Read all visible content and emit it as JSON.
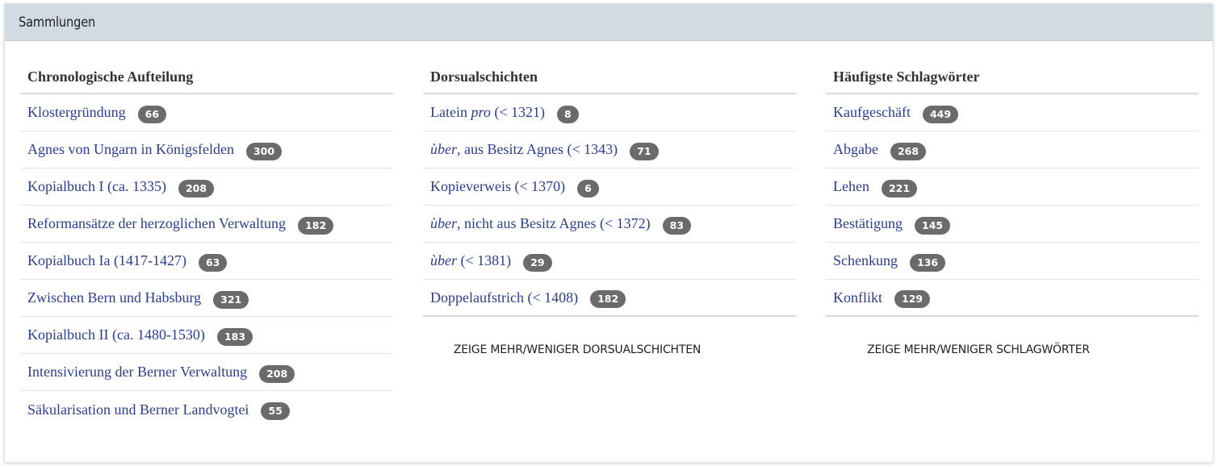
{
  "panel": {
    "title": "Sammlungen"
  },
  "columns": [
    {
      "title": "Chronologische Aufteilung",
      "items": [
        {
          "prefix": "Klostergründung",
          "em": "",
          "suffix": "",
          "count": "66"
        },
        {
          "prefix": "Agnes von Ungarn in Königsfelden",
          "em": "",
          "suffix": "",
          "count": "300"
        },
        {
          "prefix": "Kopialbuch I (ca. 1335)",
          "em": "",
          "suffix": "",
          "count": "208"
        },
        {
          "prefix": "Reformansätze der herzoglichen Verwaltung",
          "em": "",
          "suffix": "",
          "count": "182"
        },
        {
          "prefix": "Kopialbuch Ia (1417-1427)",
          "em": "",
          "suffix": "",
          "count": "63"
        },
        {
          "prefix": "Zwischen Bern und Habsburg",
          "em": "",
          "suffix": "",
          "count": "321"
        },
        {
          "prefix": "Kopialbuch II (ca. 1480-1530)",
          "em": "",
          "suffix": "",
          "count": "183"
        },
        {
          "prefix": "Intensivierung der Berner Verwaltung",
          "em": "",
          "suffix": "",
          "count": "208"
        },
        {
          "prefix": "Säkularisation und Berner Landvogtei",
          "em": "",
          "suffix": "",
          "count": "55"
        }
      ],
      "more": ""
    },
    {
      "title": "Dorsualschichten",
      "items": [
        {
          "prefix": "Latein ",
          "em": "pro",
          "suffix": " (< 1321)",
          "count": "8"
        },
        {
          "prefix": "",
          "em": "ùber",
          "suffix": ", aus Besitz Agnes (< 1343)",
          "count": "71"
        },
        {
          "prefix": "Kopieverweis (< 1370)",
          "em": "",
          "suffix": "",
          "count": "6"
        },
        {
          "prefix": "",
          "em": "ùber",
          "suffix": ", nicht aus Besitz Agnes (< 1372)",
          "count": "83"
        },
        {
          "prefix": "",
          "em": "ùber",
          "suffix": " (< 1381)",
          "count": "29"
        },
        {
          "prefix": "Doppelaufstrich (< 1408)",
          "em": "",
          "suffix": "",
          "count": "182"
        }
      ],
      "more": "ZEIGE MEHR/WENIGER DORSUALSCHICHTEN"
    },
    {
      "title": "Häufigste Schlagwörter",
      "items": [
        {
          "prefix": "Kaufgeschäft",
          "em": "",
          "suffix": "",
          "count": "449"
        },
        {
          "prefix": "Abgabe",
          "em": "",
          "suffix": "",
          "count": "268"
        },
        {
          "prefix": "Lehen",
          "em": "",
          "suffix": "",
          "count": "221"
        },
        {
          "prefix": "Bestätigung",
          "em": "",
          "suffix": "",
          "count": "145"
        },
        {
          "prefix": "Schenkung",
          "em": "",
          "suffix": "",
          "count": "136"
        },
        {
          "prefix": "Konflikt",
          "em": "",
          "suffix": "",
          "count": "129"
        }
      ],
      "more": "ZEIGE MEHR/WENIGER SCHLAGWÖRTER"
    }
  ]
}
